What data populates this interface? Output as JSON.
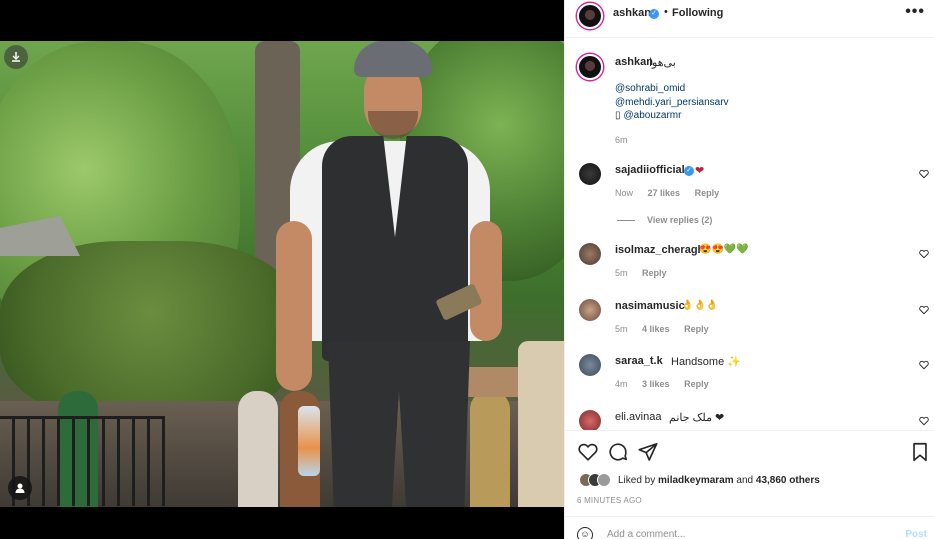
{
  "post": {
    "author": "ashkan",
    "follow_state": "Following",
    "more_label": "•••",
    "caption_text": "بی‌هوا",
    "mentions": [
      "@sohrabi_omid",
      "@mehdi.yari_persiansarv",
      "@abouzarmr"
    ],
    "mention_box": "▯",
    "caption_time": "6m"
  },
  "comments": [
    {
      "user": "sajadiiofficial",
      "text": "❤",
      "time": "Now",
      "likes": "27 likes",
      "reply": "Reply"
    },
    {
      "user": "isolmaz_cheraghi",
      "text": "😍😍💚💚",
      "time": "5m",
      "likes": "",
      "reply": "Reply"
    },
    {
      "user": "nasimamusic",
      "text": "👌👌👌",
      "time": "5m",
      "likes": "4 likes",
      "reply": "Reply"
    },
    {
      "user": "saraa_t.k",
      "text": "Handsome ✨",
      "time": "4m",
      "likes": "3 likes",
      "reply": "Reply"
    },
    {
      "user": "eli.avinaa",
      "text": "ملک جانم ❤",
      "time": "",
      "likes": "",
      "reply": ""
    }
  ],
  "view_replies": "View replies (2)",
  "likes": {
    "prefix": "Liked by ",
    "user": "miladkeymaram",
    "middle": " and ",
    "others": "43,860 others"
  },
  "time_ago": "6 MINUTES AGO",
  "add_comment": {
    "placeholder": "Add a comment...",
    "post_label": "Post"
  },
  "icons": {
    "download": "download-icon",
    "user_tag": "user-tag-icon",
    "heart": "heart-icon",
    "comment": "comment-icon",
    "share": "share-icon",
    "save": "bookmark-icon",
    "emoji": "emoji-icon"
  },
  "colors": {
    "link": "#00376b",
    "verified": "#3897f0",
    "muted": "#8e8e8e",
    "post_disabled": "#b2dffc"
  }
}
